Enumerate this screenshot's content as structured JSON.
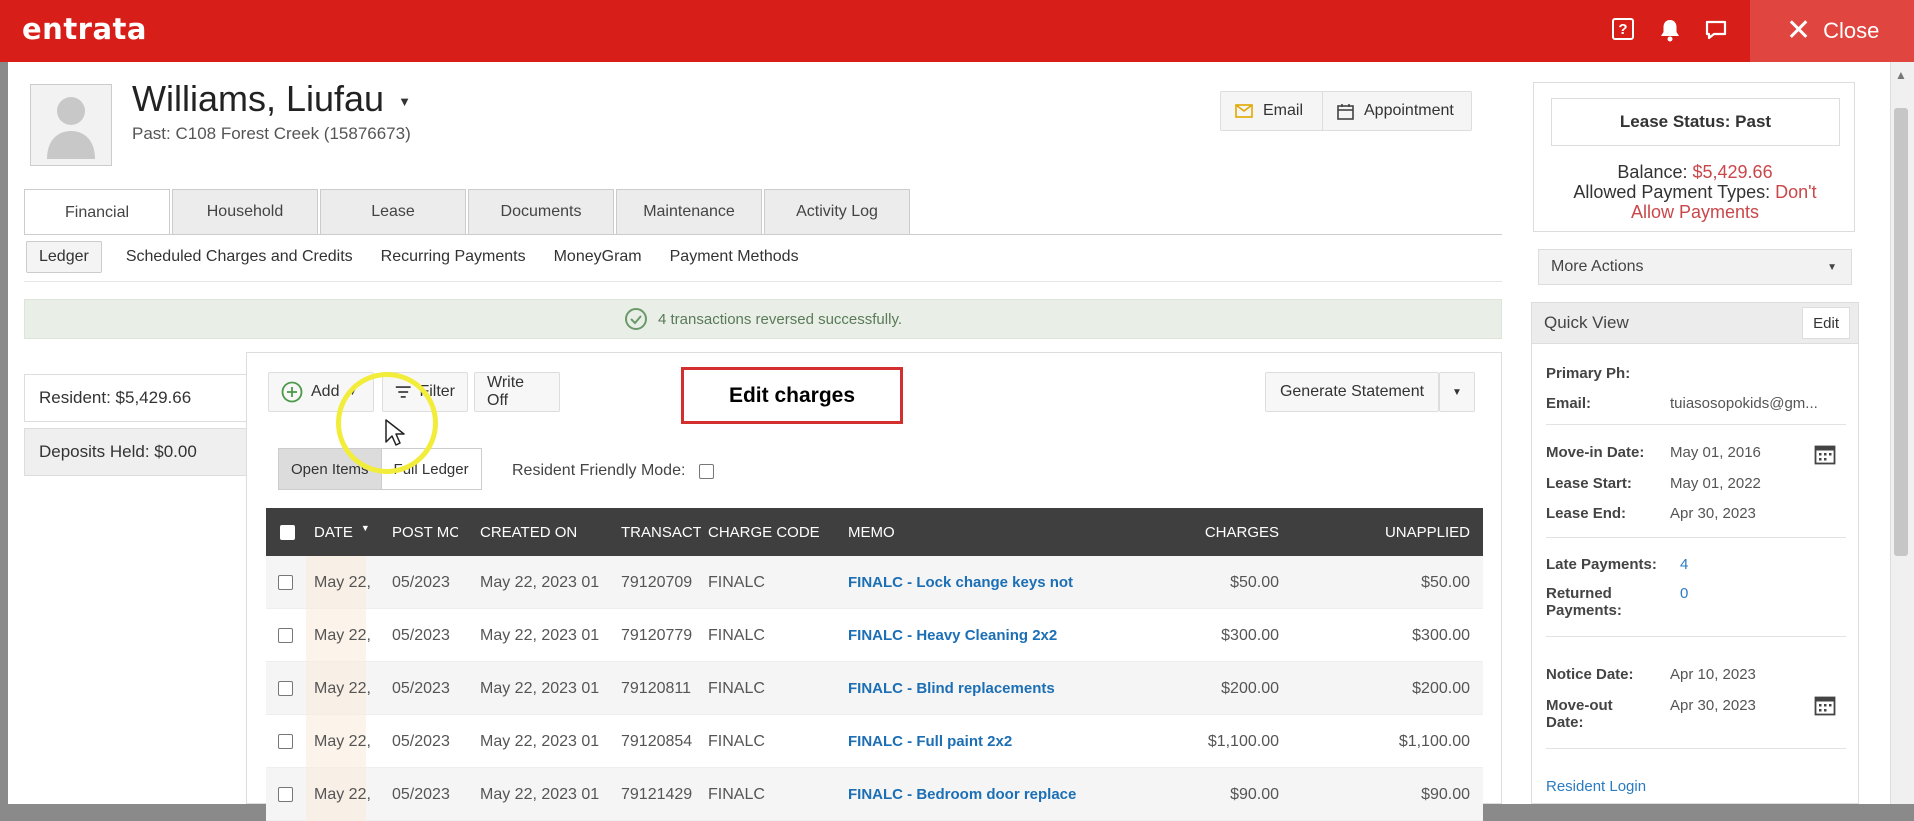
{
  "topbar": {
    "logo": "entrata",
    "close_label": "Close"
  },
  "resident": {
    "name": "Williams, Liufau",
    "subtitle": "Past: C108 Forest Creek (15876673)"
  },
  "header_buttons": {
    "email": "Email",
    "appointment": "Appointment"
  },
  "tabs": [
    "Financial",
    "Household",
    "Lease",
    "Documents",
    "Maintenance",
    "Activity Log"
  ],
  "subtabs": [
    "Ledger",
    "Scheduled Charges and Credits",
    "Recurring Payments",
    "MoneyGram",
    "Payment Methods"
  ],
  "success_message": "4 transactions reversed successfully.",
  "balances": {
    "resident": "Resident: $5,429.66",
    "deposits": "Deposits Held: $0.00"
  },
  "toolbar": {
    "add": "Add",
    "filter": "Filter",
    "write_off": "Write Off",
    "generate_statement": "Generate Statement"
  },
  "overlay_label": "Edit charges",
  "view_toggle": {
    "open_items": "Open Items",
    "full_ledger": "Full Ledger",
    "resident_friendly": "Resident Friendly Mode:"
  },
  "table": {
    "headers": {
      "date": "DATE",
      "post_month": "POST MC",
      "created_on": "CREATED ON",
      "transaction": "TRANSACT",
      "charge_code": "CHARGE CODE",
      "memo": "MEMO",
      "charges": "CHARGES",
      "unapplied": "UNAPPLIED"
    },
    "rows": [
      {
        "date": "May 22,",
        "post": "05/2023",
        "created": "May 22, 2023 01",
        "txn": "79120709",
        "code": "FINALC",
        "memo": "FINALC - Lock change keys not",
        "charges": "$50.00",
        "unapplied": "$50.00"
      },
      {
        "date": "May 22,",
        "post": "05/2023",
        "created": "May 22, 2023 01",
        "txn": "79120779",
        "code": "FINALC",
        "memo": "FINALC - Heavy Cleaning 2x2",
        "charges": "$300.00",
        "unapplied": "$300.00"
      },
      {
        "date": "May 22,",
        "post": "05/2023",
        "created": "May 22, 2023 01",
        "txn": "79120811",
        "code": "FINALC",
        "memo": "FINALC - Blind replacements",
        "charges": "$200.00",
        "unapplied": "$200.00"
      },
      {
        "date": "May 22,",
        "post": "05/2023",
        "created": "May 22, 2023 01",
        "txn": "79120854",
        "code": "FINALC",
        "memo": "FINALC - Full paint 2x2",
        "charges": "$1,100.00",
        "unapplied": "$1,100.00"
      },
      {
        "date": "May 22,",
        "post": "05/2023",
        "created": "May 22, 2023 01",
        "txn": "79121429",
        "code": "FINALC",
        "memo": "FINALC - Bedroom door replace",
        "charges": "$90.00",
        "unapplied": "$90.00"
      }
    ]
  },
  "lease_status": {
    "title": "Lease Status: Past",
    "balance_label": "Balance:",
    "balance_value": "$5,429.66",
    "payment_types_label": "Allowed Payment Types:",
    "payment_types_value_1": "Don't",
    "payment_types_value_2": "Allow Payments",
    "more_actions": "More Actions"
  },
  "quick_view": {
    "title": "Quick View",
    "edit": "Edit",
    "primary_phone_label": "Primary Ph:",
    "email_label": "Email:",
    "email_value": "tuiasosopokids@gm...",
    "move_in_label": "Move-in Date:",
    "move_in_value": "May 01, 2016",
    "lease_start_label": "Lease Start:",
    "lease_start_value": "May 01, 2022",
    "lease_end_label": "Lease End:",
    "lease_end_value": "Apr 30, 2023",
    "late_payments_label": "Late Payments:",
    "late_payments_value": "4",
    "returned_label_1": "Returned",
    "returned_label_2": "Payments:",
    "returned_value": "0",
    "notice_label": "Notice Date:",
    "notice_value": "Apr 10, 2023",
    "move_out_label_1": "Move-out",
    "move_out_label_2": "Date:",
    "move_out_value": "Apr 30, 2023",
    "resident_login": "Resident Login"
  },
  "colors": {
    "brand_red": "#d81e18",
    "link_blue": "#1c6fb5",
    "balance_red": "#c9474a",
    "header_dark": "#3f3f3f"
  }
}
